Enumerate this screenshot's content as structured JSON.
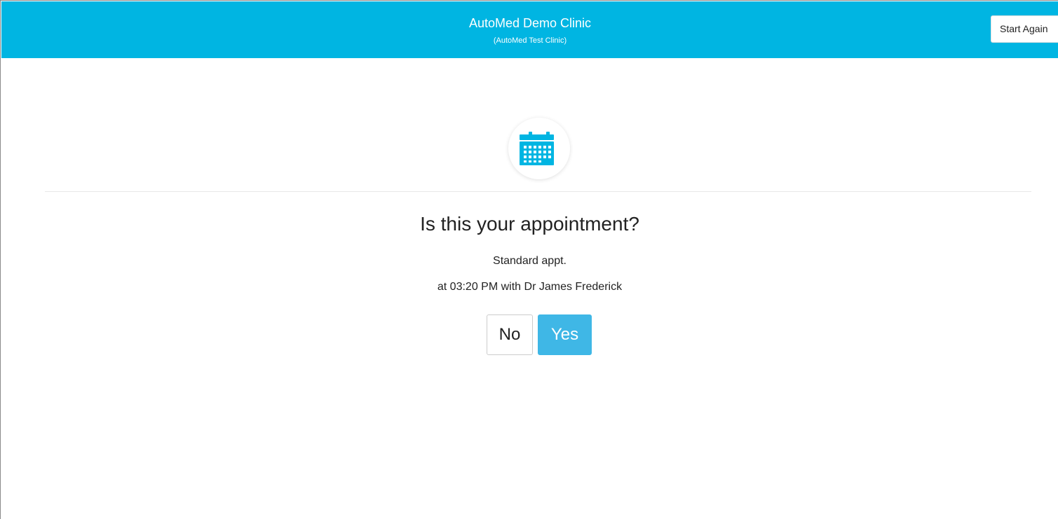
{
  "header": {
    "clinic_name": "AutoMed Demo Clinic",
    "clinic_subtitle": "(AutoMed Test Clinic)",
    "start_again_label": "Start Again"
  },
  "main": {
    "icon": "calendar-icon",
    "question": "Is this your appointment?",
    "appointment_type": "Standard appt.",
    "appointment_detail": "at 03:20 PM with Dr James Frederick",
    "no_label": "No",
    "yes_label": "Yes"
  },
  "colors": {
    "header_background": "#00b5e2",
    "yes_button": "#3fb7e6",
    "icon": "#00b5e2"
  }
}
